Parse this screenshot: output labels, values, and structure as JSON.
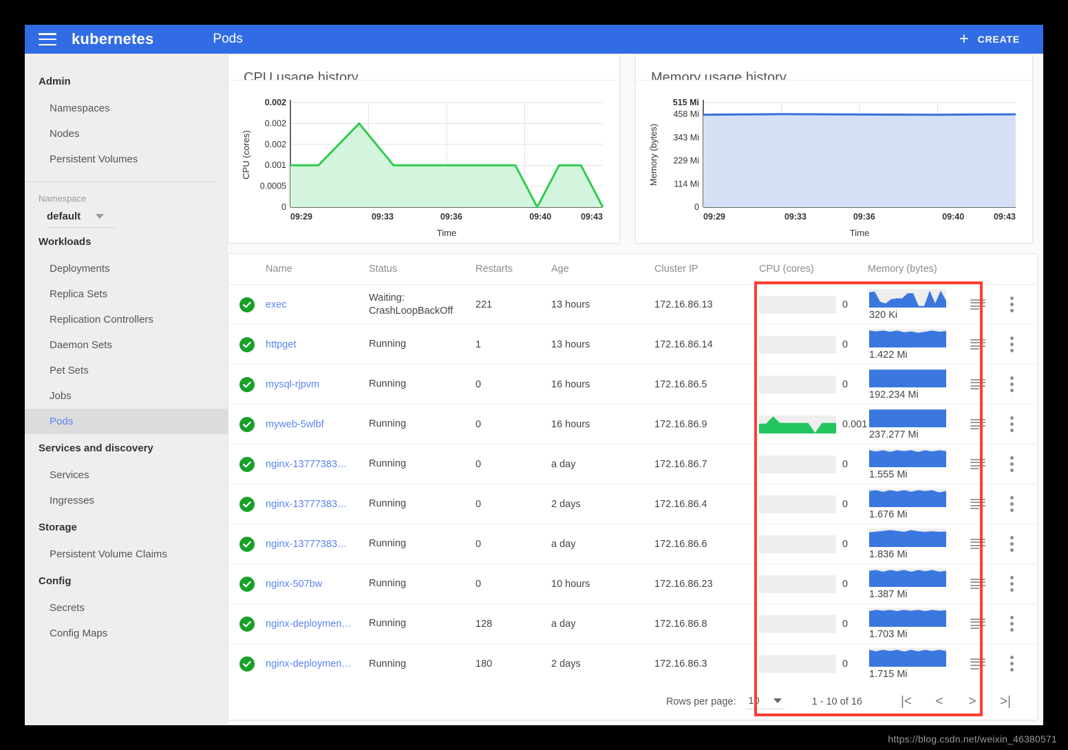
{
  "topbar": {
    "brand": "kubernetes",
    "page_title": "Pods",
    "create_label": "CREATE",
    "plus": "+",
    "bg_color": "#326ce5"
  },
  "sidebar": {
    "groups": [
      {
        "head": "Admin",
        "items": [
          "Namespaces",
          "Nodes",
          "Persistent Volumes"
        ]
      },
      {
        "head": "Workloads",
        "items": [
          "Deployments",
          "Replica Sets",
          "Replication Controllers",
          "Daemon Sets",
          "Pet Sets",
          "Jobs",
          "Pods"
        ]
      },
      {
        "head": "Services and discovery",
        "items": [
          "Services",
          "Ingresses"
        ]
      },
      {
        "head": "Storage",
        "items": [
          "Persistent Volume Claims"
        ]
      },
      {
        "head": "Config",
        "items": [
          "Secrets",
          "Config Maps"
        ]
      }
    ],
    "active_item": "Pods",
    "namespace_label": "Namespace",
    "namespace_value": "default"
  },
  "chart_data": [
    {
      "type": "area",
      "title": "CPU usage history",
      "xlabel": "Time",
      "ylabel": "CPU (cores)",
      "ytick_labels": [
        "0.002",
        "0.002",
        "0.002",
        "0.001",
        "0.0005",
        "0"
      ],
      "ytick_values": [
        0.0025,
        0.002,
        0.0015,
        0.001,
        0.0005,
        0
      ],
      "xtick_labels": [
        "09:29",
        "09:33",
        "09:36",
        "09:40",
        "09:43"
      ],
      "ylim": [
        0,
        0.0025
      ],
      "grid": true,
      "line_color": "#2ecc4f",
      "fill_color": "#d4f5dd",
      "x": [
        0,
        0.09,
        0.22,
        0.33,
        0.5,
        0.64,
        0.72,
        0.79,
        0.86,
        0.93,
        1.0
      ],
      "values": [
        0.001,
        0.001,
        0.002,
        0.001,
        0.001,
        0.001,
        0.001,
        0.0,
        0.001,
        0.001,
        0.0
      ]
    },
    {
      "type": "area",
      "title": "Memory usage history",
      "xlabel": "Time",
      "ylabel": "Memory (bytes)",
      "ytick_labels": [
        "515 Mi",
        "458 Mi",
        "343 Mi",
        "229 Mi",
        "114 Mi",
        "0"
      ],
      "ytick_values": [
        515,
        458,
        343,
        229,
        114,
        0
      ],
      "xtick_labels": [
        "09:29",
        "09:33",
        "09:36",
        "09:40",
        "09:43"
      ],
      "ylim": [
        0,
        515
      ],
      "grid": true,
      "line_color": "#3a6fd8",
      "fill_color": "#d5e0f7",
      "x": [
        0,
        0.25,
        0.5,
        0.75,
        1.0
      ],
      "values": [
        455,
        458,
        456,
        455,
        457
      ]
    }
  ],
  "table": {
    "headers": [
      "",
      "Name",
      "Status",
      "Restarts",
      "Age",
      "Cluster IP",
      "CPU (cores)",
      "Memory (bytes)",
      "",
      ""
    ],
    "rows": [
      {
        "status_icon": "check-circle",
        "name": "exec",
        "status": "Waiting:\nCrashLoopBackOff",
        "restarts": "221",
        "age": "13 hours",
        "cluster_ip": "172.16.86.13",
        "cpu": "0",
        "memory": "320 Ki",
        "cpu_spark": [
          0,
          0,
          0,
          0,
          0,
          0,
          0,
          0,
          0,
          0,
          0,
          0
        ],
        "mem_spark": [
          0.85,
          0.9,
          0.3,
          0.2,
          0.45,
          0.5,
          0.5,
          0.8,
          0.8,
          0.05,
          0.05,
          0.95,
          0.2,
          0.95,
          0.35
        ]
      },
      {
        "status_icon": "check-circle",
        "name": "httpget",
        "status": "Running",
        "restarts": "1",
        "age": "13 hours",
        "cluster_ip": "172.16.86.14",
        "cpu": "0",
        "memory": "1.422 Mi",
        "cpu_spark": [
          0,
          0,
          0,
          0,
          0,
          0,
          0,
          0,
          0,
          0,
          0,
          0
        ],
        "mem_spark": [
          0.95,
          0.9,
          0.95,
          0.88,
          0.95,
          0.85,
          0.9,
          0.82,
          0.88,
          0.95,
          0.88,
          0.92
        ]
      },
      {
        "status_icon": "check-circle",
        "name": "mysql-rjpvm",
        "status": "Running",
        "restarts": "0",
        "age": "16 hours",
        "cluster_ip": "172.16.86.5",
        "cpu": "0",
        "memory": "192.234 Mi",
        "cpu_spark": [
          0,
          0,
          0,
          0,
          0,
          0,
          0,
          0,
          0,
          0,
          0,
          0
        ],
        "mem_spark": [
          1,
          1,
          1,
          1,
          1,
          1,
          1,
          1,
          1,
          1,
          1,
          1
        ]
      },
      {
        "status_icon": "check-circle",
        "name": "myweb-5wlbf",
        "status": "Running",
        "restarts": "0",
        "age": "16 hours",
        "cluster_ip": "172.16.86.9",
        "cpu": "0.001",
        "memory": "237.277 Mi",
        "cpu_spark": [
          0.55,
          0.55,
          1.0,
          0.6,
          0.6,
          0.6,
          0.6,
          0.6,
          0.0,
          0.6,
          0.6,
          0.6
        ],
        "mem_spark": [
          1,
          1,
          1,
          1,
          1,
          1,
          1,
          1,
          1,
          1,
          1,
          1
        ]
      },
      {
        "status_icon": "check-circle",
        "name": "nginx-13777383…",
        "status": "Running",
        "restarts": "0",
        "age": "a day",
        "cluster_ip": "172.16.86.7",
        "cpu": "0",
        "memory": "1.555 Mi",
        "cpu_spark": [
          0,
          0,
          0,
          0,
          0,
          0,
          0,
          0,
          0,
          0,
          0,
          0
        ],
        "mem_spark": [
          0.95,
          0.88,
          0.95,
          0.86,
          0.95,
          0.9,
          0.95,
          0.85,
          0.95,
          0.88,
          0.95,
          0.9
        ]
      },
      {
        "status_icon": "check-circle",
        "name": "nginx-13777383…",
        "status": "Running",
        "restarts": "0",
        "age": "2 days",
        "cluster_ip": "172.16.86.4",
        "cpu": "0",
        "memory": "1.676 Mi",
        "cpu_spark": [
          0,
          0,
          0,
          0,
          0,
          0,
          0,
          0,
          0,
          0,
          0,
          0
        ],
        "mem_spark": [
          0.9,
          0.95,
          0.85,
          0.95,
          0.88,
          0.95,
          0.86,
          0.95,
          0.9,
          0.95,
          0.82,
          0.9
        ]
      },
      {
        "status_icon": "check-circle",
        "name": "nginx-13777383…",
        "status": "Running",
        "restarts": "0",
        "age": "a day",
        "cluster_ip": "172.16.86.6",
        "cpu": "0",
        "memory": "1.836 Mi",
        "cpu_spark": [
          0,
          0,
          0,
          0,
          0,
          0,
          0,
          0,
          0,
          0,
          0,
          0
        ],
        "mem_spark": [
          0.82,
          0.86,
          0.9,
          0.95,
          0.9,
          0.85,
          0.95,
          0.88,
          0.85,
          0.88,
          0.85,
          0.86
        ]
      },
      {
        "status_icon": "check-circle",
        "name": "nginx-507bw",
        "status": "Running",
        "restarts": "0",
        "age": "10 hours",
        "cluster_ip": "172.16.86.23",
        "cpu": "0",
        "memory": "1.387 Mi",
        "cpu_spark": [
          0,
          0,
          0,
          0,
          0,
          0,
          0,
          0,
          0,
          0,
          0,
          0
        ],
        "mem_spark": [
          0.9,
          0.95,
          0.85,
          0.95,
          0.88,
          0.95,
          0.85,
          0.95,
          0.88,
          0.95,
          0.85,
          0.9
        ]
      },
      {
        "status_icon": "check-circle",
        "name": "nginx-deploymen…",
        "status": "Running",
        "restarts": "128",
        "age": "a day",
        "cluster_ip": "172.16.86.8",
        "cpu": "0",
        "memory": "1.703 Mi",
        "cpu_spark": [
          0,
          0,
          0,
          0,
          0,
          0,
          0,
          0,
          0,
          0,
          0,
          0
        ],
        "mem_spark": [
          0.88,
          0.95,
          0.9,
          0.95,
          0.88,
          0.95,
          0.9,
          0.95,
          0.88,
          0.95,
          0.9,
          0.93
        ]
      },
      {
        "status_icon": "check-circle",
        "name": "nginx-deploymen…",
        "status": "Running",
        "restarts": "180",
        "age": "2 days",
        "cluster_ip": "172.16.86.3",
        "cpu": "0",
        "memory": "1.715 Mi",
        "cpu_spark": [
          0,
          0,
          0,
          0,
          0,
          0,
          0,
          0,
          0,
          0,
          0,
          0
        ],
        "mem_spark": [
          0.95,
          0.86,
          0.95,
          0.88,
          0.95,
          0.85,
          0.95,
          0.86,
          0.95,
          0.88,
          0.95,
          0.88
        ]
      }
    ]
  },
  "pagination": {
    "rows_per_page_label": "Rows per page:",
    "rows_per_page_value": "10",
    "range": "1 - 10 of 16",
    "first": "|<",
    "prev": "<",
    "next": ">",
    "last": ">|"
  },
  "watermark": "https://blog.csdn.net/weixin_46380571",
  "highlight_color": "#ff3b30"
}
